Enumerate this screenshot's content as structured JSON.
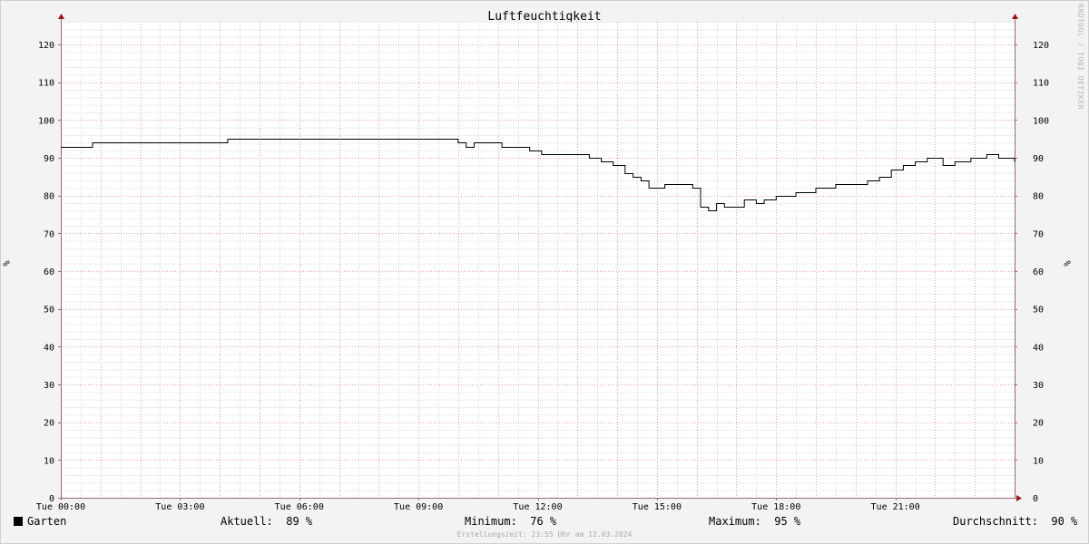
{
  "chart_data": {
    "type": "line",
    "title": "Luftfeuchtigkeit",
    "ylabel": "%",
    "xlabel": "",
    "ylim": [
      0,
      126
    ],
    "xlim": [
      0,
      24
    ],
    "yticks": [
      0,
      10,
      20,
      30,
      40,
      50,
      60,
      70,
      80,
      90,
      100,
      110,
      120
    ],
    "xticks": [
      {
        "value": 0,
        "label": "Tue 00:00"
      },
      {
        "value": 3,
        "label": "Tue 03:00"
      },
      {
        "value": 6,
        "label": "Tue 06:00"
      },
      {
        "value": 9,
        "label": "Tue 09:00"
      },
      {
        "value": 12,
        "label": "Tue 12:00"
      },
      {
        "value": 15,
        "label": "Tue 15:00"
      },
      {
        "value": 18,
        "label": "Tue 18:00"
      },
      {
        "value": 21,
        "label": "Tue 21:00"
      }
    ],
    "grid": true,
    "series": [
      {
        "name": "Garten",
        "color": "#000000",
        "x": [
          0,
          0.4,
          0.8,
          1.2,
          1.6,
          2.0,
          2.4,
          2.8,
          3.2,
          3.6,
          4.0,
          4.2,
          4.6,
          5.0,
          6.0,
          7.0,
          8.0,
          9.0,
          9.8,
          10.0,
          10.2,
          10.4,
          10.8,
          11.1,
          11.6,
          11.8,
          12.1,
          12.5,
          13.0,
          13.3,
          13.6,
          13.9,
          14.2,
          14.4,
          14.6,
          14.8,
          15.0,
          15.2,
          15.6,
          15.9,
          16.1,
          16.3,
          16.5,
          16.7,
          16.9,
          17.2,
          17.5,
          17.7,
          18.0,
          18.5,
          19.0,
          19.5,
          19.9,
          20.1,
          20.3,
          20.6,
          20.9,
          21.2,
          21.5,
          21.8,
          22.0,
          22.2,
          22.5,
          22.9,
          23.3,
          23.6,
          24.0
        ],
        "values": [
          93,
          93,
          94,
          94,
          94,
          94,
          94,
          94,
          94,
          94,
          94,
          95,
          95,
          95,
          95,
          95,
          95,
          95,
          95,
          94,
          93,
          94,
          94,
          93,
          93,
          92,
          91,
          91,
          91,
          90,
          89,
          88,
          86,
          85,
          84,
          82,
          82,
          83,
          83,
          82,
          77,
          76,
          78,
          77,
          77,
          79,
          78,
          79,
          80,
          81,
          82,
          83,
          83,
          83,
          84,
          85,
          87,
          88,
          89,
          90,
          90,
          88,
          89,
          90,
          91,
          90,
          89
        ]
      }
    ]
  },
  "watermark": "RRDTOOL / TOBI OETIKER",
  "unit_left": "%",
  "unit_right": "%",
  "legend": {
    "series_name": "Garten",
    "current": "Aktuell:  89 %",
    "minimum": "Minimum:  76 %",
    "maximum": "Maximum:  95 %",
    "average": "Durchschnitt:  90 %"
  },
  "footer": "Erstellungszeit: 23:55 Uhr am 12.03.2024"
}
